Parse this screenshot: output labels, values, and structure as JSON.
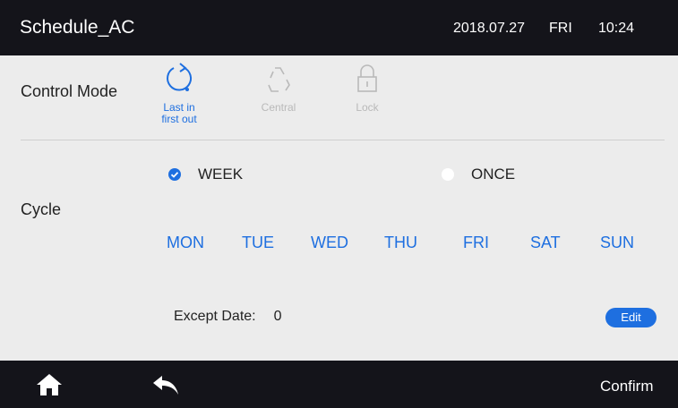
{
  "header": {
    "title": "Schedule_AC",
    "date": "2018.07.27",
    "weekday": "FRI",
    "time": "10:24"
  },
  "control_mode": {
    "label": "Control Mode",
    "modes": [
      {
        "label_line1": "Last in",
        "label_line2": "first out",
        "icon": "cycle-icon",
        "active": true
      },
      {
        "label_line1": "Central",
        "icon": "recycle-icon",
        "active": false
      },
      {
        "label_line1": "Lock",
        "icon": "lock-icon",
        "active": false
      }
    ]
  },
  "cycle": {
    "label": "Cycle",
    "options": [
      {
        "label": "WEEK",
        "selected": true
      },
      {
        "label": "ONCE",
        "selected": false
      }
    ],
    "days": [
      "MON",
      "TUE",
      "WED",
      "THU",
      "FRI",
      "SAT",
      "SUN"
    ]
  },
  "except": {
    "label": "Except Date:",
    "count": "0",
    "edit_label": "Edit"
  },
  "footer": {
    "confirm_label": "Confirm",
    "home_icon": "home-icon",
    "back_icon": "back-arrow-icon"
  },
  "colors": {
    "accent": "#1e6fe0",
    "bar": "#14141a",
    "panel": "#ececec",
    "inactive": "#b9b9b9"
  }
}
